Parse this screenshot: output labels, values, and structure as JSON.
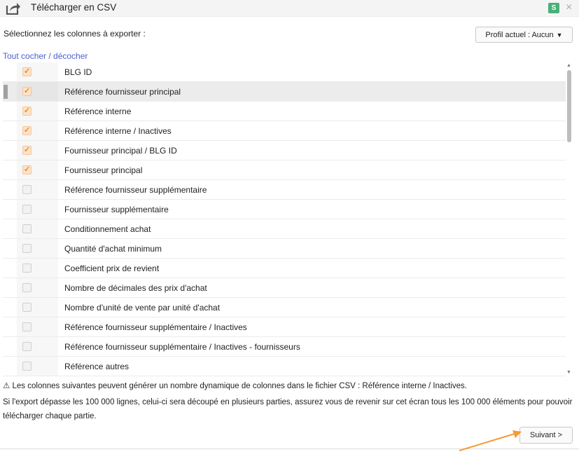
{
  "header": {
    "title": "Télécharger en CSV",
    "badge": "S",
    "close_icon": "close-icon",
    "export_icon": "share-export-icon"
  },
  "toolbar": {
    "select_label": "Sélectionnez les colonnes à exporter :",
    "profile_label": "Profil actuel : Aucun",
    "profile_caret": "▼"
  },
  "toggle_all": "Tout cocher / décocher",
  "columns": [
    {
      "label": "BLG ID",
      "checked": true
    },
    {
      "label": "Référence fournisseur principal",
      "checked": true
    },
    {
      "label": "Référence interne",
      "checked": true
    },
    {
      "label": "Référence interne / Inactives",
      "checked": true
    },
    {
      "label": "Fournisseur principal / BLG ID",
      "checked": true
    },
    {
      "label": "Fournisseur principal",
      "checked": true
    },
    {
      "label": "Référence fournisseur supplémentaire",
      "checked": false
    },
    {
      "label": "Fournisseur supplémentaire",
      "checked": false
    },
    {
      "label": "Conditionnement achat",
      "checked": false
    },
    {
      "label": "Quantité d'achat minimum",
      "checked": false
    },
    {
      "label": "Coefficient prix de revient",
      "checked": false
    },
    {
      "label": "Nombre de décimales des prix d'achat",
      "checked": false
    },
    {
      "label": "Nombre d'unité de vente par unité d'achat",
      "checked": false
    },
    {
      "label": "Référence fournisseur supplémentaire / Inactives",
      "checked": false
    },
    {
      "label": "Référence fournisseur supplémentaire / Inactives - fournisseurs",
      "checked": false
    },
    {
      "label": "Référence autres",
      "checked": false
    }
  ],
  "highlighted_row": 1,
  "notice": {
    "warning": "⚠ Les colonnes suivantes peuvent générer un nombre dynamique de colonnes dans le fichier CSV : Référence interne / Inactives.",
    "info": "Si l'export dépasse les 100 000 lignes, celui-ci sera découpé en plusieurs parties, assurez vous de revenir sur cet écran tous les 100 000 éléments pour pouvoir télécharger chaque partie."
  },
  "footer": {
    "next_label": "Suivant >"
  },
  "colors": {
    "accent_check": "#f08a24",
    "link": "#4b5fd1",
    "badge": "#4caf7a",
    "annotation_arrow": "#f39c34"
  }
}
